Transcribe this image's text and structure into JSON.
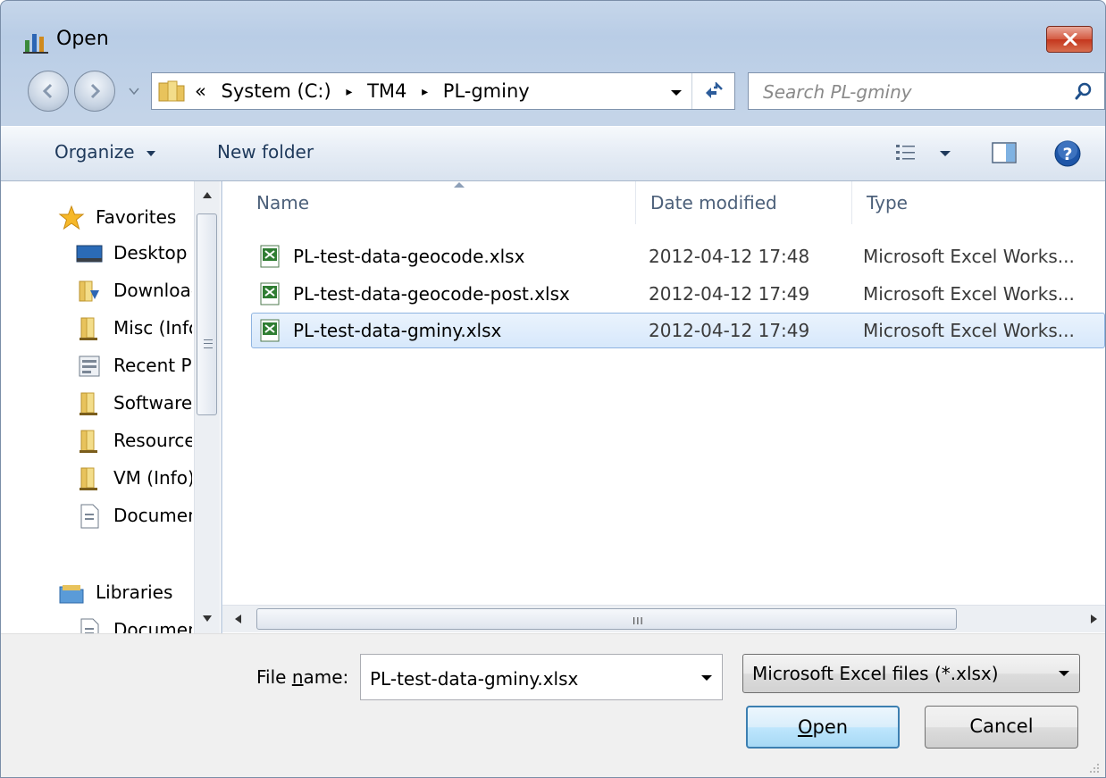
{
  "window": {
    "title": "Open"
  },
  "address": {
    "prefix": "«",
    "crumbs": [
      "System (C:)",
      "TM4",
      "PL-gminy"
    ],
    "separator": "▸"
  },
  "search": {
    "placeholder": "Search PL-gminy"
  },
  "toolbar": {
    "organize_label": "Organize",
    "new_folder_label": "New folder"
  },
  "nav_pane": {
    "favorites_label": "Favorites",
    "items": [
      {
        "label": "Desktop",
        "icon": "desktop-icon"
      },
      {
        "label": "Downloads",
        "icon": "downloads-folder-icon"
      },
      {
        "label": "Misc (Info)",
        "icon": "folder-icon"
      },
      {
        "label": "Recent Places",
        "icon": "recent-places-icon"
      },
      {
        "label": "Software",
        "icon": "folder-icon"
      },
      {
        "label": "Resources",
        "icon": "folder-icon"
      },
      {
        "label": "VM (Info)",
        "icon": "folder-icon"
      },
      {
        "label": "Documents",
        "icon": "document-icon"
      }
    ],
    "libraries_label": "Libraries",
    "libraries_items": [
      {
        "label": "Documents",
        "icon": "document-icon"
      }
    ]
  },
  "file_list": {
    "columns": [
      "Name",
      "Date modified",
      "Type"
    ],
    "rows": [
      {
        "name": "PL-test-data-geocode.xlsx",
        "date": "2012-04-12 17:48",
        "type": "Microsoft Excel Works...",
        "selected": false
      },
      {
        "name": "PL-test-data-geocode-post.xlsx",
        "date": "2012-04-12 17:49",
        "type": "Microsoft Excel Works...",
        "selected": false
      },
      {
        "name": "PL-test-data-gminy.xlsx",
        "date": "2012-04-12 17:49",
        "type": "Microsoft Excel Works...",
        "selected": true
      }
    ],
    "hscroll_grip": "III"
  },
  "bottom": {
    "file_name_label_pre": "File ",
    "file_name_label_u": "n",
    "file_name_label_post": "ame:",
    "file_name_value": "PL-test-data-gminy.xlsx",
    "file_type_value": "Microsoft Excel files (*.xlsx)",
    "open_label_u": "O",
    "open_label_post": "pen",
    "cancel_label": "Cancel"
  },
  "colors": {
    "selection": "#d7e8fb",
    "accent": "#3c7fb1",
    "close": "#c4361d"
  }
}
